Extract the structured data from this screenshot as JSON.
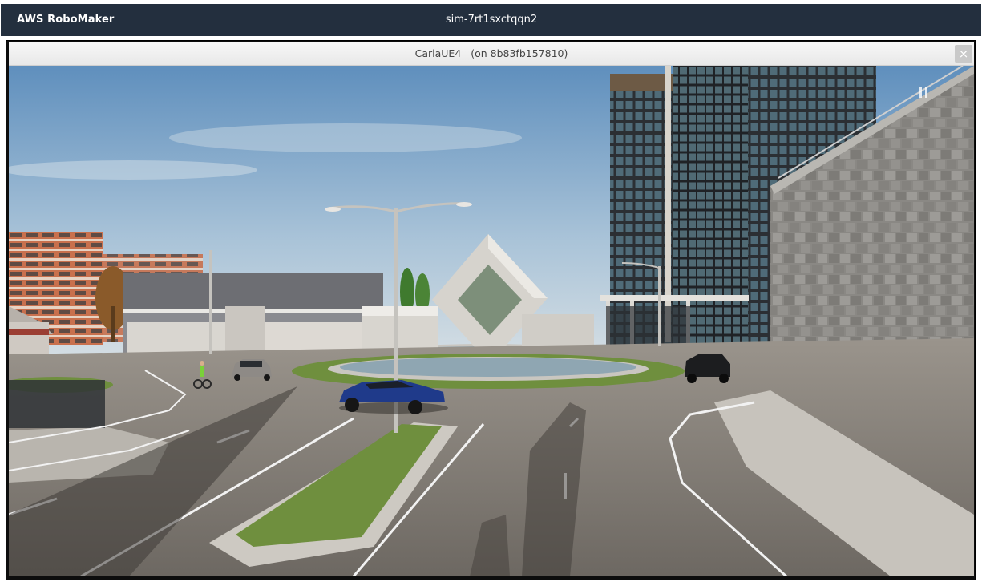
{
  "console": {
    "brand": "AWS RoboMaker",
    "simulation_id": "sim-7rt1sxctqqn2"
  },
  "window": {
    "title": "CarlaUE4   (on 8b83fb157810)",
    "close_glyph": "×"
  },
  "scene": {
    "description_icon": "3d-render-viewport",
    "colors": {
      "navbar": "#232f3e",
      "sky_top": "#5f8fbd",
      "sky_bottom": "#c6d6e2",
      "asphalt": "#7b7670",
      "grass": "#6f8f3e"
    }
  }
}
